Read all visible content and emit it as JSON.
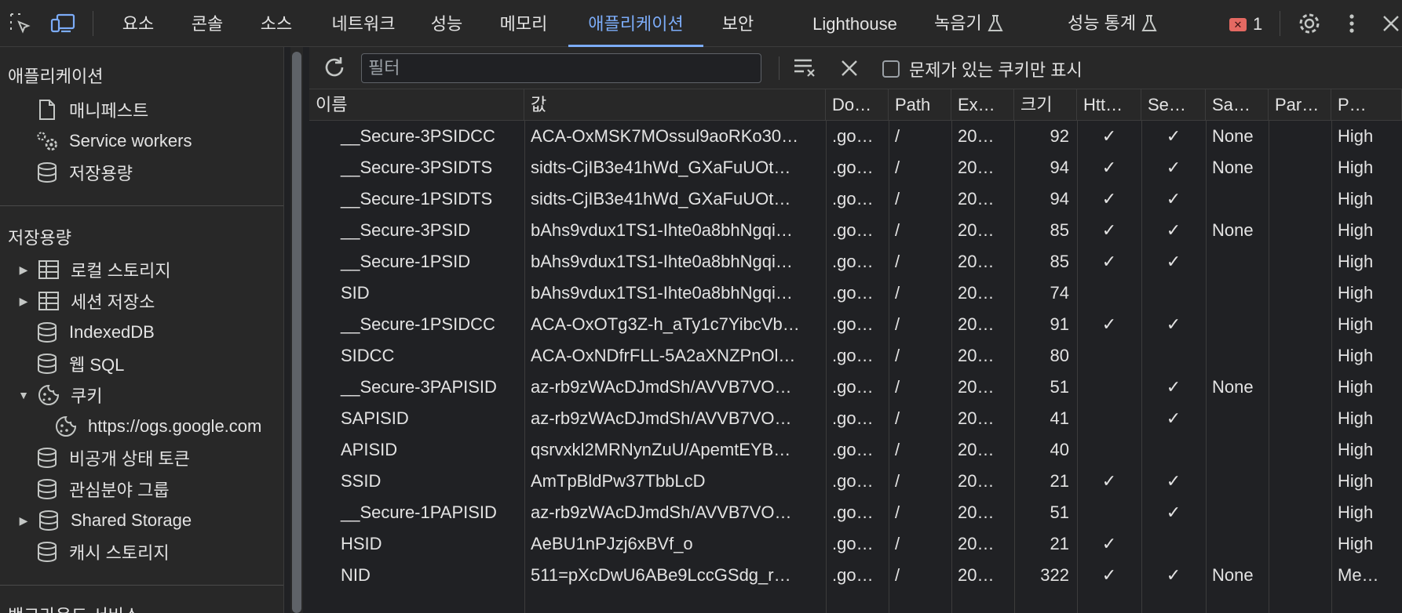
{
  "topbar": {
    "tabs": [
      "요소",
      "콘솔",
      "소스",
      "네트워크",
      "성능",
      "메모리",
      "애플리케이션",
      "보안",
      "Lighthouse",
      "녹음기",
      "성능 통계"
    ],
    "active_tab": "애플리케이션",
    "error_count": "1",
    "accent": "#7cacf8"
  },
  "sidebar": {
    "app_header": "애플리케이션",
    "app_items": [
      "매니페스트",
      "Service workers",
      "저장용량"
    ],
    "storage_header": "저장용량",
    "storage_items": [
      "로컬 스토리지",
      "세션 저장소",
      "IndexedDB",
      "웹 SQL",
      "쿠키",
      "https://ogs.google.com",
      "비공개 상태 토큰",
      "관심분야 그룹",
      "Shared Storage",
      "캐시 스토리지"
    ],
    "bg_header": "백그라운드 서비스"
  },
  "toolbar": {
    "filter_placeholder": "필터",
    "only_issues_label": "문제가 있는 쿠키만 표시"
  },
  "table": {
    "headers": [
      "이름",
      "값",
      "Do…",
      "Path",
      "Ex…",
      "크기",
      "Htt…",
      "Se…",
      "Sa…",
      "Par…",
      "P…"
    ],
    "rows": [
      [
        "__Secure-3PSIDCC",
        "ACA-OxMSK7MOssul9aoRKo30…",
        ".go…",
        "/",
        "20…",
        "92",
        "✓",
        "✓",
        "None",
        "",
        "High"
      ],
      [
        "__Secure-3PSIDTS",
        "sidts-CjIB3e41hWd_GXaFuUOt…",
        ".go…",
        "/",
        "20…",
        "94",
        "✓",
        "✓",
        "None",
        "",
        "High"
      ],
      [
        "__Secure-1PSIDTS",
        "sidts-CjIB3e41hWd_GXaFuUOt…",
        ".go…",
        "/",
        "20…",
        "94",
        "✓",
        "✓",
        "",
        "",
        "High"
      ],
      [
        "__Secure-3PSID",
        "bAhs9vdux1TS1-Ihte0a8bhNgqi…",
        ".go…",
        "/",
        "20…",
        "85",
        "✓",
        "✓",
        "None",
        "",
        "High"
      ],
      [
        "__Secure-1PSID",
        "bAhs9vdux1TS1-Ihte0a8bhNgqi…",
        ".go…",
        "/",
        "20…",
        "85",
        "✓",
        "✓",
        "",
        "",
        "High"
      ],
      [
        "SID",
        "bAhs9vdux1TS1-Ihte0a8bhNgqi…",
        ".go…",
        "/",
        "20…",
        "74",
        "",
        "",
        "",
        "",
        "High"
      ],
      [
        "__Secure-1PSIDCC",
        "ACA-OxOTg3Z-h_aTy1c7YibcVb…",
        ".go…",
        "/",
        "20…",
        "91",
        "✓",
        "✓",
        "",
        "",
        "High"
      ],
      [
        "SIDCC",
        "ACA-OxNDfrFLL-5A2aXNZPnOl…",
        ".go…",
        "/",
        "20…",
        "80",
        "",
        "",
        "",
        "",
        "High"
      ],
      [
        "__Secure-3PAPISID",
        "az-rb9zWAcDJmdSh/AVVB7VO…",
        ".go…",
        "/",
        "20…",
        "51",
        "",
        "✓",
        "None",
        "",
        "High"
      ],
      [
        "SAPISID",
        "az-rb9zWAcDJmdSh/AVVB7VO…",
        ".go…",
        "/",
        "20…",
        "41",
        "",
        "✓",
        "",
        "",
        "High"
      ],
      [
        "APISID",
        "qsrvxkl2MRNynZuU/ApemtEYB…",
        ".go…",
        "/",
        "20…",
        "40",
        "",
        "",
        "",
        "",
        "High"
      ],
      [
        "SSID",
        "AmTpBldPw37TbbLcD",
        ".go…",
        "/",
        "20…",
        "21",
        "✓",
        "✓",
        "",
        "",
        "High"
      ],
      [
        "__Secure-1PAPISID",
        "az-rb9zWAcDJmdSh/AVVB7VO…",
        ".go…",
        "/",
        "20…",
        "51",
        "",
        "✓",
        "",
        "",
        "High"
      ],
      [
        "HSID",
        "AeBU1nPJzj6xBVf_o",
        ".go…",
        "/",
        "20…",
        "21",
        "✓",
        "",
        "",
        "",
        "High"
      ],
      [
        "NID",
        "511=pXcDwU6ABe9LccGSdg_r…",
        ".go…",
        "/",
        "20…",
        "322",
        "✓",
        "✓",
        "None",
        "",
        "Me…"
      ]
    ]
  }
}
